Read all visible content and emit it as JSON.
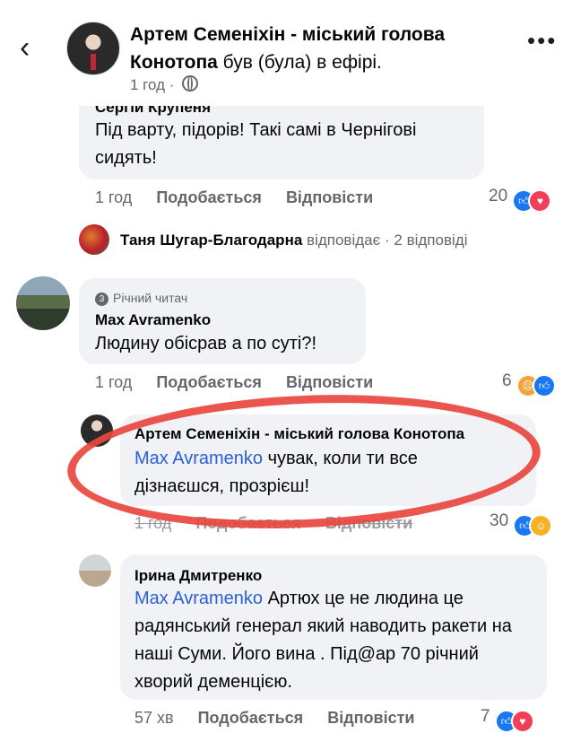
{
  "header": {
    "back_icon": "chevron-left-icon",
    "title_bold": "Артем Семеніхін - міський голова Конотопа",
    "title_rest": " був (була) в ефірі.",
    "time": "1 год",
    "privacy_icon": "globe-icon",
    "more_icon": "ellipsis-icon"
  },
  "comments": [
    {
      "author": "Сергій Крупеня",
      "text": "Під варту, підорів! Такі самі в Чернігові сидять!",
      "time": "1 год",
      "like": "Подобається",
      "reply": "Відповісти",
      "reaction_count": "20"
    },
    {
      "replies_author": "Таня Шугар-Благодарна",
      "replies_verb": "відповідає",
      "replies_count": "· 2 відповіді"
    },
    {
      "badge": "Річний читач",
      "author": "Max  Avramenko",
      "text": "Людину обісрав а по суті?!",
      "time": "1 год",
      "like": "Подобається",
      "reply": "Відповісти",
      "reaction_count": "6"
    },
    {
      "author": "Артем Семеніхін - міський голова Конотопа",
      "mention": "Max  Avramenko",
      "text": " чувак, коли ти все дізнаєшся, прозрієш!",
      "time": "1 год",
      "like": "Подобається",
      "reply": "Відповісти",
      "reaction_count": "30"
    },
    {
      "author": "Ірина Дмитренко",
      "mention": "Max  Avramenko",
      "text": " Артюх це не людина це радянський генерал який наводить ракети на наші Суми. Його вина . Під@ар 70 річний хворий деменцією.",
      "time": "57 хв",
      "like": "Подобається",
      "reply": "Відповісти",
      "reaction_count": "7"
    }
  ],
  "colors": {
    "annotation": "#e8473f",
    "mention": "#2a5fd8",
    "bubble": "#f0f2f5"
  }
}
